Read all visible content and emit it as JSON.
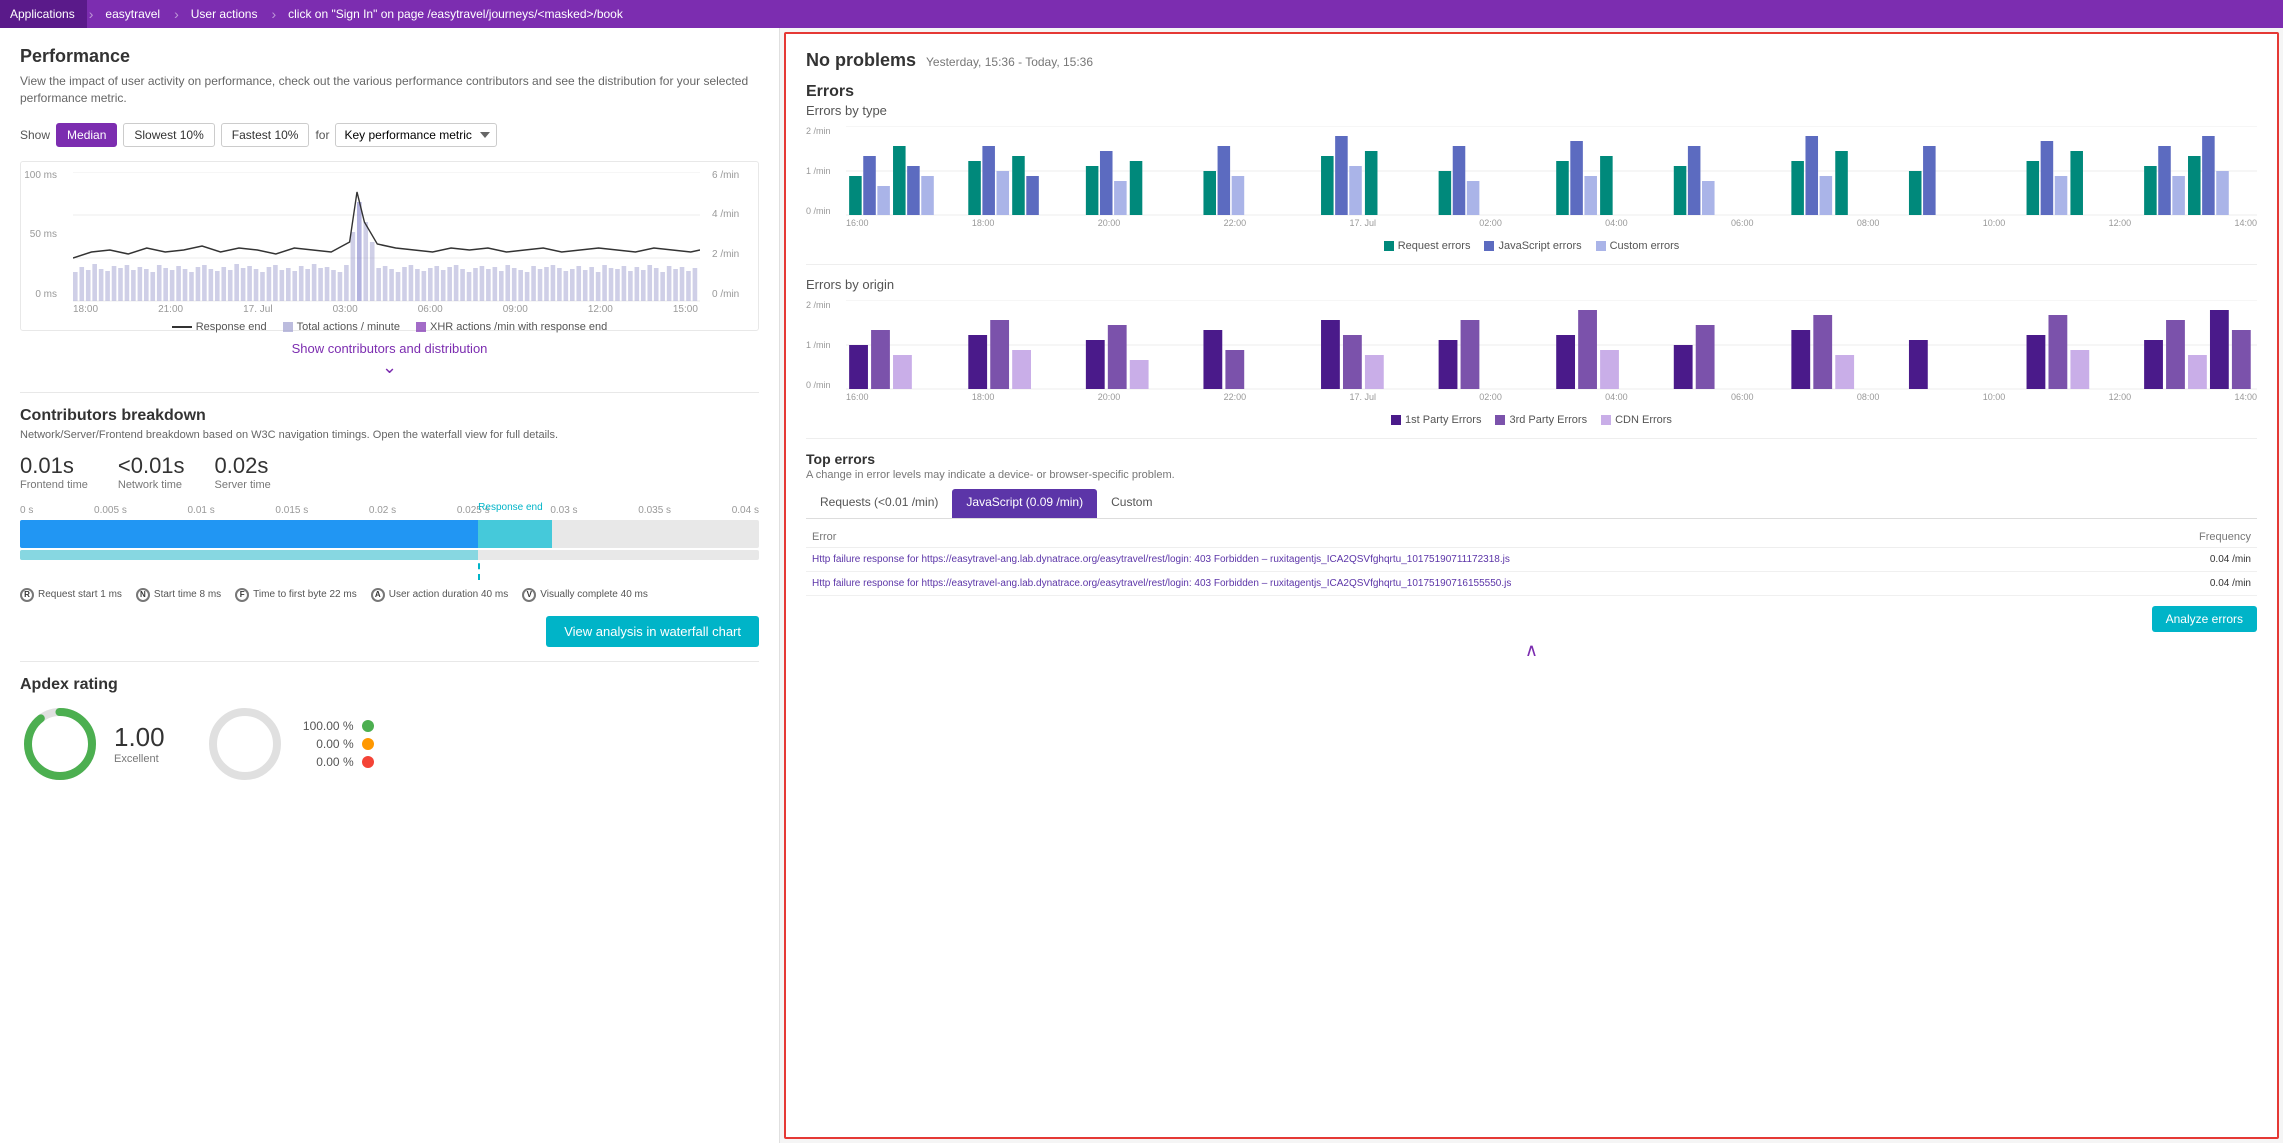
{
  "breadcrumb": {
    "items": [
      {
        "label": "Applications"
      },
      {
        "label": "easytravel"
      },
      {
        "label": "User actions"
      },
      {
        "label": "click on \"Sign In\" on page /easytravel/journeys/<masked>/book"
      }
    ]
  },
  "left_panel": {
    "performance": {
      "title": "Performance",
      "description": "View the impact of user activity on performance, check out the various performance contributors and see the distribution for your selected performance metric.",
      "show_label": "Show",
      "tabs": [
        {
          "label": "Median",
          "active": true
        },
        {
          "label": "Slowest 10%",
          "active": false
        },
        {
          "label": "Fastest 10%",
          "active": false
        }
      ],
      "for_label": "for",
      "metric_label": "Key performance metric",
      "y_labels_left": [
        "100 ms",
        "50 ms",
        "0 ms"
      ],
      "y_labels_right": [
        "6 /min",
        "4 /min",
        "2 /min",
        "0 /min"
      ],
      "x_labels": [
        "18:00",
        "21:00",
        "17. Jul",
        "03:00",
        "06:00",
        "09:00",
        "12:00",
        "15:00"
      ],
      "legend": {
        "response_end": "Response end",
        "total_actions": "Total actions / minute",
        "xhr_actions": "XHR actions /min with response end"
      },
      "show_contributors_label": "Show contributors and distribution"
    },
    "contributors": {
      "title": "Contributors breakdown",
      "description": "Network/Server/Frontend breakdown based on W3C navigation timings. Open the waterfall view for full details.",
      "frontend_time": "0.01s",
      "frontend_label": "Frontend time",
      "network_time": "<0.01s",
      "network_label": "Network time",
      "server_time": "0.02s",
      "server_label": "Server time",
      "x_labels": [
        "0 s",
        "0.005 s",
        "0.01 s",
        "0.015 s",
        "0.02 s",
        "0.025 s",
        "0.03 s",
        "0.035 s",
        "0.04 s"
      ],
      "response_end_label": "Response end",
      "markers": [
        {
          "key": "R",
          "label": "Request start 1 ms"
        },
        {
          "key": "N",
          "label": "Start time 8 ms"
        },
        {
          "key": "F",
          "label": "Time to first byte 22 ms"
        },
        {
          "key": "A",
          "label": "User action duration 40 ms"
        },
        {
          "key": "V",
          "label": "Visually complete 40 ms"
        }
      ],
      "waterfall_btn": "View analysis in waterfall chart"
    },
    "apdex": {
      "title": "Apdex rating",
      "value": "1.00",
      "label": "Excellent",
      "breakdown": [
        {
          "pct": "100.00 %",
          "color": "green"
        },
        {
          "pct": "0.00 %",
          "color": "orange"
        },
        {
          "pct": "0.00 %",
          "color": "red"
        }
      ]
    }
  },
  "right_panel": {
    "no_problems_title": "No problems",
    "no_problems_time": "Yesterday, 15:36 - Today, 15:36",
    "errors": {
      "title": "Errors",
      "by_type_title": "Errors by type",
      "by_type_y": [
        "2 /min",
        "1 /min",
        "0 /min"
      ],
      "by_type_x": [
        "16:00",
        "18:00",
        "20:00",
        "22:00",
        "17. Jul",
        "02:00",
        "04:00",
        "06:00",
        "08:00",
        "10:00",
        "12:00",
        "14:00"
      ],
      "by_type_legend": [
        {
          "label": "Request errors",
          "color": "teal"
        },
        {
          "label": "JavaScript errors",
          "color": "blue"
        },
        {
          "label": "Custom errors",
          "color": "light"
        }
      ],
      "by_origin_title": "Errors by origin",
      "by_origin_y": [
        "2 /min",
        "1 /min",
        "0 /min"
      ],
      "by_origin_x": [
        "16:00",
        "18:00",
        "20:00",
        "22:00",
        "17. Jul",
        "02:00",
        "04:00",
        "06:00",
        "08:00",
        "10:00",
        "12:00",
        "14:00"
      ],
      "by_origin_legend": [
        {
          "label": "1st Party Errors"
        },
        {
          "label": "3rd Party Errors"
        },
        {
          "label": "CDN Errors"
        }
      ],
      "top_errors_title": "Top errors",
      "top_errors_desc": "A change in error levels may indicate a device- or browser-specific problem.",
      "tabs": [
        {
          "label": "Requests (<0.01 /min)",
          "active": false
        },
        {
          "label": "JavaScript (0.09 /min)",
          "active": true
        },
        {
          "label": "Custom",
          "active": false
        }
      ],
      "table_headers": [
        "Error",
        "Frequency"
      ],
      "table_rows": [
        {
          "error": "Http failure response for https://easytravel-ang.lab.dynatrace.org/easytravel/rest/login: 403 Forbidden – ruxitagentjs_ICA2QSVfghqrtu_10175190711172318.js",
          "frequency": "0.04 /min"
        },
        {
          "error": "Http failure response for https://easytravel-ang.lab.dynatrace.org/easytravel/rest/login: 403 Forbidden – ruxitagentjs_ICA2QSVfghqrtu_10175190716155550.js",
          "frequency": "0.04 /min"
        }
      ],
      "analyze_btn": "Analyze errors",
      "collapse_label": "∧"
    }
  }
}
